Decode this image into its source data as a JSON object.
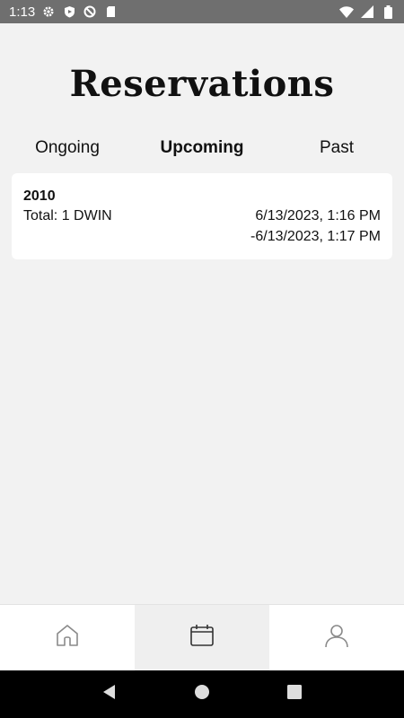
{
  "status_bar": {
    "time": "1:13",
    "left_icons": [
      "settings-icon",
      "shield-icon",
      "blocked-icon",
      "sd-card-icon"
    ],
    "right_icons": [
      "wifi-icon",
      "signal-icon",
      "battery-icon"
    ]
  },
  "page": {
    "title": "Reservations"
  },
  "tabs": [
    {
      "label": "Ongoing",
      "active": false
    },
    {
      "label": "Upcoming",
      "active": true
    },
    {
      "label": "Past",
      "active": false
    }
  ],
  "reservations": [
    {
      "title": "2010",
      "total": "Total: 1 DWIN",
      "start": "6/13/2023, 1:16 PM",
      "end": "-6/13/2023, 1:17 PM"
    }
  ],
  "bottom_nav": [
    {
      "icon": "home-icon",
      "active": false
    },
    {
      "icon": "calendar-icon",
      "active": true
    },
    {
      "icon": "profile-icon",
      "active": false
    }
  ],
  "system_nav": [
    "back-icon",
    "home-circle-icon",
    "recents-icon"
  ],
  "colors": {
    "status_bar_bg": "#6f6f6f",
    "page_bg": "#f2f2f2",
    "card_bg": "#ffffff",
    "active_nav_bg": "#efefef",
    "nav_icon": "#8a8a8a"
  }
}
